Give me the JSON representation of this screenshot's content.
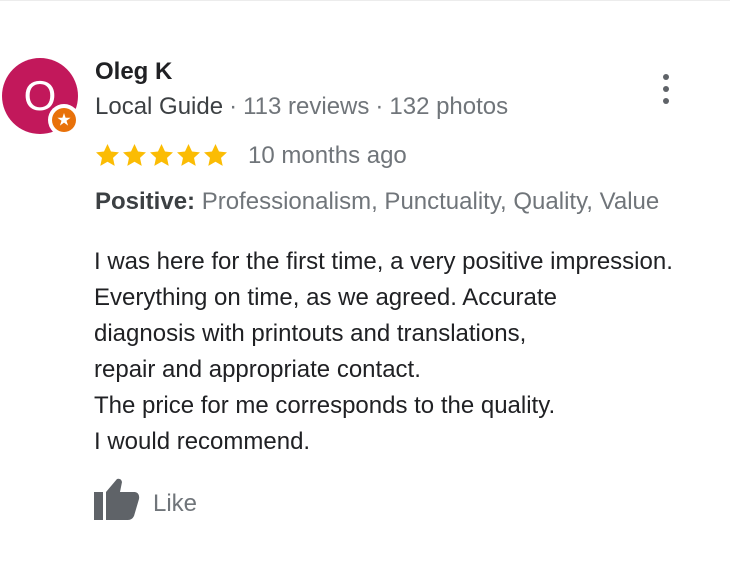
{
  "review": {
    "author": {
      "avatar_letter": "O",
      "avatar_color": "#c2185b",
      "name": "Oleg K",
      "badge_icon": "local-guide-star-icon",
      "badge_color": "#e8710a",
      "level": "Local Guide",
      "separator": "·",
      "reviews_count": "113 reviews",
      "photos_count": "132 photos"
    },
    "more_icon": "more-vert-icon",
    "rating": 5,
    "star_color": "#fbbc04",
    "time": "10 months ago",
    "positive": {
      "label": "Positive:",
      "values": "Professionalism, Punctuality, Quality, Value"
    },
    "text_lines": [
      "I was here for the first time, a very positive impression.",
      "Everything on time, as we agreed. Accurate",
      "diagnosis with printouts and translations,",
      "repair and appropriate contact.",
      "The price for me corresponds to the quality.",
      "I would recommend."
    ],
    "like": {
      "icon": "thumbs-up-icon",
      "label": "Like"
    }
  }
}
